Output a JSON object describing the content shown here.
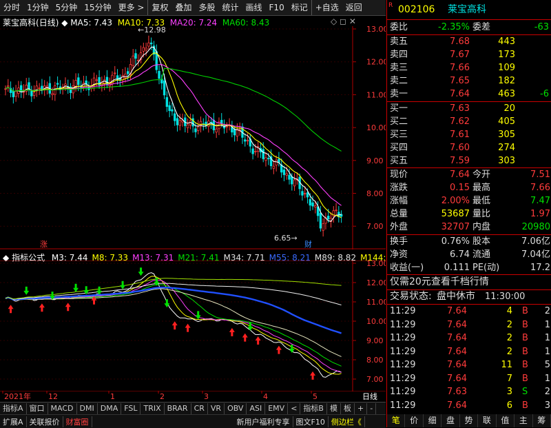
{
  "toolbar": {
    "items": [
      "分时",
      "1分钟",
      "5分钟",
      "15分钟",
      "更多 >",
      "复权",
      "叠加",
      "多股",
      "统计",
      "画线",
      "F10",
      "标记",
      "+自选",
      "返回"
    ]
  },
  "stock": {
    "name": "莱宝高科",
    "period": "(日线)",
    "code": "002106",
    "name2": "莱宝高科",
    "badge": "R"
  },
  "ma": {
    "ma5": "MA5: 7.43",
    "ma10": "MA10: 7.33",
    "ma20": "MA20: 7.24",
    "ma60": "MA60: 8.43"
  },
  "main": {
    "ylabels": [
      "13.00",
      "12.00",
      "11.00",
      "10.00",
      "9.00",
      "8.00",
      "7.00"
    ],
    "high_label": "12.98",
    "low_label": "6.65",
    "zhang": "涨",
    "cai": "财"
  },
  "indicator": {
    "name": "指标公式",
    "params": [
      "M3: 7.44",
      "M8: 7.33",
      "M13: 7.31",
      "M21: 7.41",
      "M34: 7.71",
      "M55: 8.21",
      "M89: 8.82",
      "M144: 9.4"
    ],
    "ylabels": [
      "13.00",
      "12.00",
      "11.00",
      "10.00",
      "9.00",
      "8.00",
      "7.00"
    ]
  },
  "xaxis": {
    "labels": [
      "2021年",
      "12",
      "1",
      "2",
      "3",
      "4",
      "5"
    ],
    "period": "日线"
  },
  "tabs": [
    "指标A",
    "窗口",
    "MACD",
    "DMI",
    "DMA",
    "FSL",
    "TRIX",
    "BRAR",
    "CR",
    "VR",
    "OBV",
    "ASI",
    "EMV",
    "<",
    "指标B",
    "模",
    "板",
    "+",
    "-"
  ],
  "statusbar": [
    "扩展A",
    "关联报价",
    "财富圈",
    "新用户福利专享",
    "图文F10",
    "侧边栏《"
  ],
  "quote": {
    "weibi_label": "委比",
    "weibi": "-2.35%",
    "weicha_label": "委差",
    "weicha": "-63",
    "sells": [
      {
        "l": "卖五",
        "p": "7.68",
        "v": "443",
        "c": ""
      },
      {
        "l": "卖四",
        "p": "7.67",
        "v": "173",
        "c": ""
      },
      {
        "l": "卖三",
        "p": "7.66",
        "v": "109",
        "c": ""
      },
      {
        "l": "卖二",
        "p": "7.65",
        "v": "182",
        "c": ""
      },
      {
        "l": "卖一",
        "p": "7.64",
        "v": "463",
        "c": "-6"
      }
    ],
    "buys": [
      {
        "l": "买一",
        "p": "7.63",
        "v": "20"
      },
      {
        "l": "买二",
        "p": "7.62",
        "v": "405"
      },
      {
        "l": "买三",
        "p": "7.61",
        "v": "305"
      },
      {
        "l": "买四",
        "p": "7.60",
        "v": "274"
      },
      {
        "l": "买五",
        "p": "7.59",
        "v": "303"
      }
    ],
    "stats": [
      {
        "l1": "现价",
        "v1": "7.64",
        "l2": "今开",
        "v2": "7.51"
      },
      {
        "l1": "涨跌",
        "v1": "0.15",
        "l2": "最高",
        "v2": "7.66"
      },
      {
        "l1": "涨幅",
        "v1": "2.00%",
        "l2": "最低",
        "v2": "7.47"
      },
      {
        "l1": "总量",
        "v1": "53687",
        "l2": "量比",
        "v2": "1.97"
      },
      {
        "l1": "外盘",
        "v1": "32707",
        "l2": "内盘",
        "v2": "20980"
      }
    ],
    "stats2": [
      {
        "l1": "换手",
        "v1": "0.76%",
        "l2": "股本",
        "v2": "7.06亿"
      },
      {
        "l1": "净资",
        "v1": "6.74",
        "l2": "流通",
        "v2": "7.04亿"
      },
      {
        "l1": "收益(一)",
        "v1": "0.111",
        "l2": "PE(动)",
        "v2": "17.2"
      }
    ],
    "promo": "仅需20元查看千档行情",
    "trade_state_label": "交易状态:",
    "trade_state": "盘中休市",
    "trade_time": "11:30:00",
    "ticks": [
      {
        "t": "11:29",
        "p": "7.64",
        "v": "4",
        "d": "B",
        "n": "2"
      },
      {
        "t": "11:29",
        "p": "7.64",
        "v": "2",
        "d": "B",
        "n": "1"
      },
      {
        "t": "11:29",
        "p": "7.64",
        "v": "2",
        "d": "B",
        "n": "1"
      },
      {
        "t": "11:29",
        "p": "7.64",
        "v": "2",
        "d": "B",
        "n": "1"
      },
      {
        "t": "11:29",
        "p": "7.64",
        "v": "11",
        "d": "B",
        "n": "5"
      },
      {
        "t": "11:29",
        "p": "7.64",
        "v": "7",
        "d": "B",
        "n": "1"
      },
      {
        "t": "11:29",
        "p": "7.63",
        "v": "3",
        "d": "S",
        "n": "2"
      },
      {
        "t": "11:29",
        "p": "7.64",
        "v": "6",
        "d": "B",
        "n": "3"
      }
    ],
    "bottom_tabs": [
      "笔",
      "价",
      "细",
      "盘",
      "势",
      "联",
      "值",
      "主",
      "筹"
    ]
  }
}
